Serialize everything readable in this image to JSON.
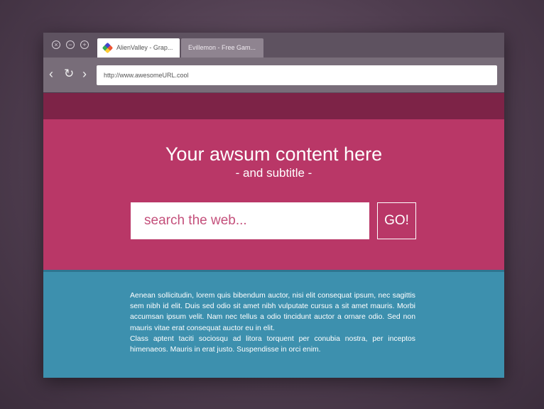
{
  "browser": {
    "window_controls": [
      "close-icon",
      "minimize-icon",
      "maximize-icon"
    ],
    "tabs": [
      {
        "label": "AlienValley - Grap...",
        "active": true
      },
      {
        "label": "Evillemon - Free Gam...",
        "active": false
      }
    ],
    "url": "http://www.awesomeURL.cool"
  },
  "page": {
    "title": "Your awsum content here",
    "subtitle": "- and subtitle -",
    "search_placeholder": "search the web...",
    "go_label": "GO!",
    "paragraphs": [
      "Aenean sollicitudin, lorem quis bibendum auctor, nisi elit consequat ipsum, nec sagittis sem nibh id elit. Duis sed odio sit amet nibh vulputate cursus a sit amet mauris. Morbi accumsan ipsum velit. Nam nec tellus a odio tincidunt auctor a ornare odio. Sed non  mauris vitae erat consequat auctor eu in elit.",
      "Class aptent taciti sociosqu ad litora torquent per conubia nostra, per inceptos himenaeos. Mauris in erat justo. Suspendisse in orci enim."
    ]
  },
  "colors": {
    "hero": "#b93767",
    "band": "#7d2347",
    "content": "#3d90ae"
  }
}
